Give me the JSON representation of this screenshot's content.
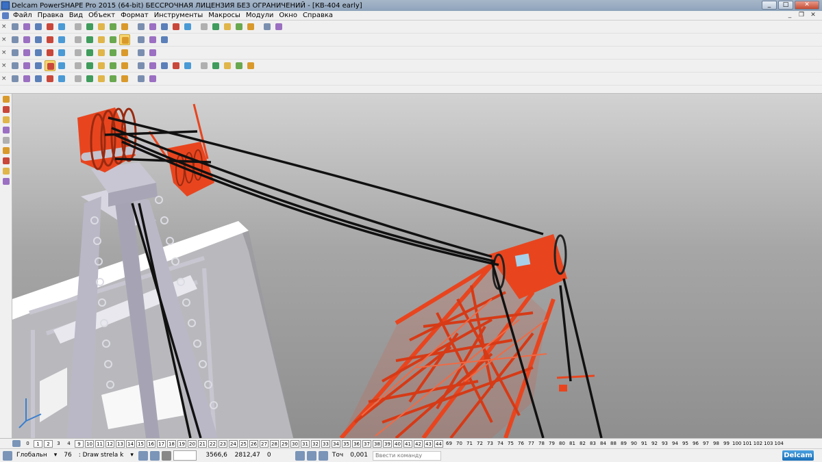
{
  "window": {
    "title": "Delcam PowerSHAPE Pro 2015 (64-bit) БЕССРОЧНАЯ ЛИЦЕНЗИЯ БЕЗ ОГРАНИЧЕНИЙ - [КВ-404 early]",
    "minimize": "_",
    "maximize": "□",
    "close": "✕"
  },
  "menu": {
    "items": [
      "Файл",
      "Правка",
      "Вид",
      "Объект",
      "Формат",
      "Инструменты",
      "Макросы",
      "Модули",
      "Окно",
      "Справка"
    ],
    "mdi_minimize": "_",
    "mdi_restore": "❐",
    "mdi_close": "✕"
  },
  "toolbars": {
    "row1_icons": [
      "new-file-icon",
      "open-file-icon",
      "save-icon",
      "save-as-icon",
      "print-icon",
      "cut-icon",
      "copy-icon",
      "paste-icon",
      "delete-icon",
      "undo-icon",
      "redo-icon",
      "erase-icon",
      "select-icon",
      "wireframe-icon",
      "point-icon",
      "line-icon",
      "circle-icon",
      "curve-icon",
      "surface-icon",
      "solid-icon",
      "assembly-icon",
      "tools-icon"
    ],
    "row2_icons": [
      "view-iso-icon",
      "view-top-icon",
      "view-front-icon",
      "view-right-icon",
      "rotate-icon",
      "zoom-icon",
      "zoom-in-icon",
      "zoom-out-icon",
      "pan-icon",
      "shade-icon",
      "wire-shade-icon",
      "light-icon",
      "dynamic-icon"
    ],
    "row3_icons": [
      "workplane-icon",
      "level-icon",
      "layer-icon",
      "color-icon",
      "material-icon",
      "render-icon",
      "texture-icon",
      "analyze-icon",
      "measure-icon",
      "section-icon",
      "drafting-icon",
      "symbol-icon"
    ],
    "row4_icons": [
      "select-all-icon",
      "deselect-icon",
      "filter-icon",
      "quick-select-icon",
      "group-icon",
      "ungroup-icon",
      "transform-icon",
      "move-icon",
      "copy-move-icon",
      "rotate-obj-icon",
      "mirror-icon",
      "scale-icon",
      "offset-icon",
      "blank-icon",
      "unblank-icon",
      "lock-icon",
      "unlock-icon",
      "hide-icon",
      "show-icon",
      "visible-icon"
    ],
    "row5_icons": [
      "sketch-icon",
      "feature-icon",
      "extrude-icon",
      "revolve-icon",
      "sweep-icon",
      "loft-icon",
      "fillet-icon",
      "chamfer-icon",
      "shell-icon",
      "boolean-icon",
      "split-icon",
      "pattern-icon"
    ]
  },
  "left_tools": [
    "pointer-icon",
    "grid-select-icon",
    "solid-primitive-icon",
    "box-icon",
    "cylinder-icon",
    "cone-icon",
    "sphere-icon",
    "torus-icon",
    "spring-icon"
  ],
  "levels": {
    "numbers": [
      "0",
      "1",
      "2",
      "3",
      "4",
      "9",
      "10",
      "11",
      "12",
      "13",
      "14",
      "15",
      "16",
      "17",
      "18",
      "19",
      "20",
      "21",
      "22",
      "23",
      "24",
      "25",
      "26",
      "27",
      "28",
      "29",
      "30",
      "31",
      "32",
      "33",
      "34",
      "35",
      "36",
      "37",
      "38",
      "39",
      "40",
      "41",
      "42",
      "43",
      "44",
      "69",
      "70",
      "71",
      "72",
      "73",
      "74",
      "75",
      "76",
      "77",
      "78",
      "79",
      "80",
      "81",
      "82",
      "83",
      "84",
      "88",
      "89",
      "90",
      "91",
      "92",
      "93",
      "94",
      "95",
      "96",
      "97",
      "98",
      "99",
      "100",
      "101",
      "102",
      "103",
      "104"
    ],
    "highlighted": [
      "1",
      "2",
      "9",
      "10",
      "11",
      "12",
      "13",
      "14",
      "15",
      "16",
      "17",
      "18",
      "19",
      "20",
      "21",
      "22",
      "23",
      "24",
      "25",
      "26",
      "27",
      "28",
      "29",
      "30",
      "31",
      "32",
      "33",
      "34",
      "35",
      "36",
      "37",
      "38",
      "39",
      "40",
      "41",
      "42",
      "43",
      "44"
    ]
  },
  "status": {
    "workplane": "Глобальн",
    "level_number": "76",
    "level_name": ": Draw strela k",
    "x": "3566,6",
    "y": "2812,47",
    "z": "0",
    "tolerance_label": "Точ",
    "tolerance": "0,001",
    "command_placeholder": "Ввести команду",
    "brand": "Delcam"
  },
  "colors": {
    "crane_red": "#e8451f",
    "tower_grey": "#b9b7c4",
    "cable": "#111111",
    "platform": "#f4f4f6",
    "background_top": "#d2d2d2",
    "background_bottom": "#8f8f8f"
  }
}
